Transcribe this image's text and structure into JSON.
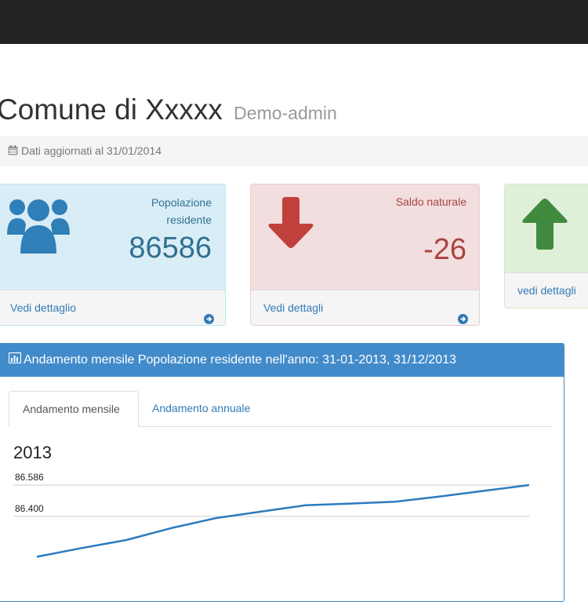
{
  "header": {
    "title": "Comune di Xxxxx",
    "subtitle": "Demo-admin"
  },
  "info": {
    "text": "Dati aggiornati al 31/01/2014",
    "icon": "calendar-icon"
  },
  "colors": {
    "navbar": "#222222",
    "info_blue": "#31708f",
    "danger_red": "#a94442",
    "success_green": "#3c763d",
    "primary": "#428bca",
    "line": "#2c7bbf"
  },
  "panels": {
    "population": {
      "label": "Popolazione residente",
      "value": "86586",
      "footer": "Vedi dettaglio",
      "icon": "users-icon"
    },
    "natural_balance": {
      "label": "Saldo naturale",
      "value": "-26",
      "footer": "Vedi dettagli",
      "icon": "arrow-down-icon"
    },
    "third": {
      "footer": "vedi dettagli",
      "icon": "arrow-up-icon"
    }
  },
  "chart_panel": {
    "title": "Andamento mensile Popolazione residente nell'anno: 31-01-2013, 31/12/2013",
    "icon": "bar-chart-icon",
    "tabs": [
      {
        "label": "Andamento mensile",
        "active": true
      },
      {
        "label": "Andamento annuale",
        "active": false
      }
    ]
  },
  "chart_data": {
    "type": "line",
    "title": "2013",
    "xlabel": "",
    "ylabel": "",
    "ylim": [
      86120,
      86586
    ],
    "yticks": [
      {
        "value": 86586,
        "label": "86.586"
      },
      {
        "value": 86400,
        "label": "86.400"
      }
    ],
    "x": [
      1,
      2,
      3,
      4,
      5,
      6,
      7,
      8,
      9,
      10,
      11,
      12
    ],
    "series": [
      {
        "values": [
          86160,
          86212,
          86260,
          86330,
          86390,
          86428,
          86466,
          86476,
          86487,
          86518,
          86552,
          86586
        ]
      }
    ],
    "grid": true,
    "legend": "none"
  }
}
